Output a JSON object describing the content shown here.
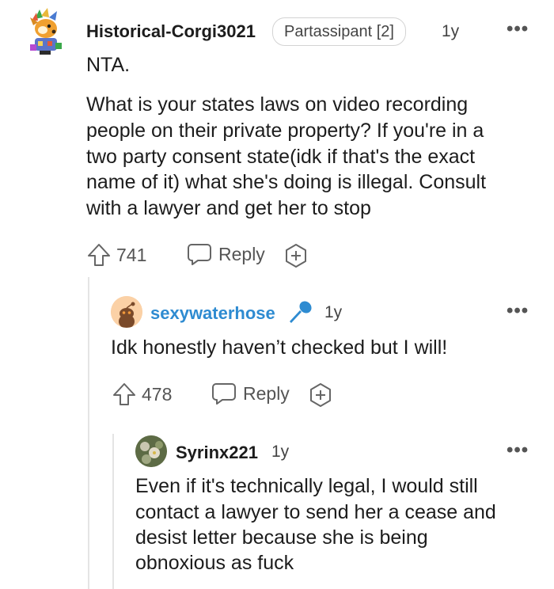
{
  "comments": [
    {
      "username": "Historical-Corgi3021",
      "flair": "Partassipant [2]",
      "age": "1y",
      "more": "•••",
      "paragraphs": [
        "NTA.",
        "What is your states laws on video recording",
        "people on their private property? If you're in a",
        "two party consent state(idk if that's the exact",
        "name of it) what she's doing is illegal. Consult",
        "with a lawyer and get her to stop"
      ],
      "upvotes": "741",
      "reply_label": "Reply"
    },
    {
      "username": "sexywaterhose",
      "age": "1y",
      "more": "•••",
      "paragraphs": [
        "Idk honestly haven’t checked but I will!"
      ],
      "upvotes": "478",
      "reply_label": "Reply",
      "badge_icon": "microphone-icon",
      "username_color": "#2e8bd1"
    },
    {
      "username": "Syrinx221",
      "age": "1y",
      "more": "•••",
      "paragraphs": [
        "Even if it's technically legal, I would still",
        "contact a lawyer to send her a cease and",
        "desist letter because she is being",
        "obnoxious as fuck"
      ]
    }
  ],
  "icons": {
    "upvote": "upvote-arrow-icon",
    "reply": "speech-bubble-icon",
    "award": "award-plus-icon"
  }
}
